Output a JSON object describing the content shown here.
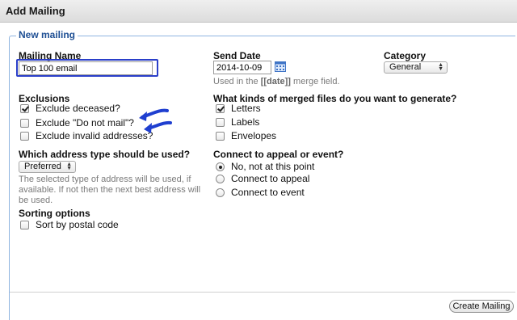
{
  "window": {
    "title": "Add Mailing"
  },
  "section": {
    "legend": "New mailing"
  },
  "mailing_name": {
    "label": "Mailing Name",
    "value": "Top 100 email"
  },
  "send_date": {
    "label": "Send Date",
    "value": "2014-10-09",
    "help_prefix": "Used in the ",
    "help_token": "[[date]]",
    "help_suffix": " merge field."
  },
  "category": {
    "label": "Category",
    "selected": "General"
  },
  "exclusions": {
    "label": "Exclusions",
    "items": [
      {
        "label": "Exclude deceased?",
        "checked": true
      },
      {
        "label": "Exclude \"Do not mail\"?",
        "checked": false
      },
      {
        "label": "Exclude invalid addresses?",
        "checked": false
      }
    ]
  },
  "merged_files": {
    "label": "What kinds of merged files do you want to generate?",
    "items": [
      {
        "label": "Letters",
        "checked": true
      },
      {
        "label": "Labels",
        "checked": false
      },
      {
        "label": "Envelopes",
        "checked": false
      }
    ]
  },
  "address_type": {
    "label": "Which address type should be used?",
    "selected": "Preferred",
    "help": "The selected type of address will be used, if available. If not then the next best address will be used."
  },
  "appeal": {
    "label": "Connect to appeal or event?",
    "options": [
      {
        "label": "No, not at this point",
        "selected": true
      },
      {
        "label": "Connect to appeal",
        "selected": false
      },
      {
        "label": "Connect to event",
        "selected": false
      }
    ]
  },
  "sorting": {
    "label": "Sorting options",
    "items": [
      {
        "label": "Sort by postal code",
        "checked": false
      }
    ]
  },
  "actions": {
    "create_label": "Create Mailing"
  },
  "icons": {
    "calendar": "calendar-icon",
    "annotation": "arrow-annotation-icon"
  },
  "colors": {
    "legend": "#1e4f94",
    "focus_ring": "#2a3fc9",
    "annotation": "#1f3fd0"
  }
}
